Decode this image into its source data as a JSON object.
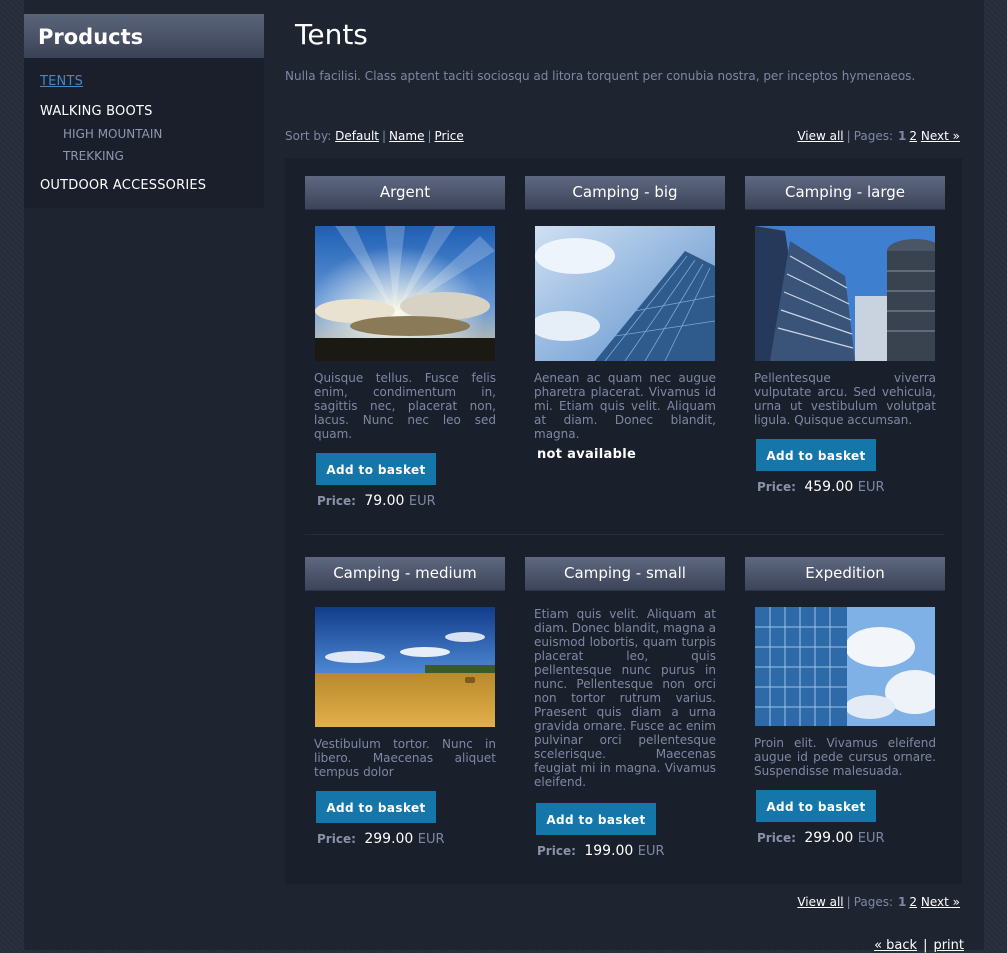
{
  "sidebar": {
    "title": "Products",
    "categories": [
      {
        "label": "TENTS",
        "active": true,
        "sub": []
      },
      {
        "label": "WALKING BOOTS",
        "active": false,
        "sub": [
          "HIGH MOUNTAIN",
          "TREKKING"
        ]
      },
      {
        "label": "OUTDOOR ACCESSORIES",
        "active": false,
        "sub": []
      }
    ]
  },
  "main": {
    "title": "Tents",
    "intro": "Nulla facilisi. Class aptent taciti sociosqu ad litora torquent per conubia nostra, per inceptos hymenaeos.",
    "sort": {
      "label": "Sort by:",
      "options": [
        "Default",
        "Name",
        "Price"
      ]
    },
    "pager": {
      "view_all": "View all",
      "pages_label": "Pages:",
      "current": "1",
      "page2": "2",
      "next": "Next »"
    },
    "button_label": "Add to basket",
    "price_label": "Price:",
    "currency": "EUR",
    "products": [
      {
        "name": "Argent",
        "desc": "Quisque tellus. Fusce felis enim, condimentum in, sagittis nec, placerat non, lacus. Nunc nec leo sed quam.",
        "price": "79.00",
        "available": true,
        "image": "sunburst-sky"
      },
      {
        "name": "Camping - big",
        "desc": "Aenean ac quam nec augue pharetra placerat. Vivamus id mi. Etiam quis velit. Aliquam at diam. Donec blandit, magna.",
        "price": "",
        "available": false,
        "na_text": "not available",
        "image": "glass-tower-sky"
      },
      {
        "name": "Camping - large",
        "desc": "Pellentesque viverra vulputate arcu. Sed vehicula, urna ut vestibulum volutpat ligula. Quisque accumsan.",
        "price": "459.00",
        "available": true,
        "image": "skyscrapers"
      },
      {
        "name": "Camping - medium",
        "desc": "Vestibulum tortor. Nunc in libero. Maecenas aliquet tempus dolor",
        "price": "299.00",
        "available": true,
        "image": "wheat-field"
      },
      {
        "name": "Camping - small",
        "desc": "Etiam quis velit. Aliquam at diam. Donec blandit, magna a euismod lobortis, quam turpis placerat leo, quis pellentesque nunc purus in nunc. Pellentesque non orci non tortor rutrum varius. Praesent quis diam a urna gravida ornare. Fusce ac enim pulvinar orci pellentesque scelerisque. Maecenas feugiat mi in magna. Vivamus eleifend.",
        "price": "199.00",
        "available": true,
        "image": ""
      },
      {
        "name": "Expedition",
        "desc": "Proin elit. Vivamus eleifend augue id pede cursus ornare. Suspendisse malesuada.",
        "price": "299.00",
        "available": true,
        "image": "glass-facade-clouds"
      }
    ],
    "bottom": {
      "back": "« back",
      "print": "print"
    }
  },
  "colors": {
    "accent_button": "#1577a9",
    "active_link": "#4a86c0",
    "muted_text": "#7f88a2"
  }
}
